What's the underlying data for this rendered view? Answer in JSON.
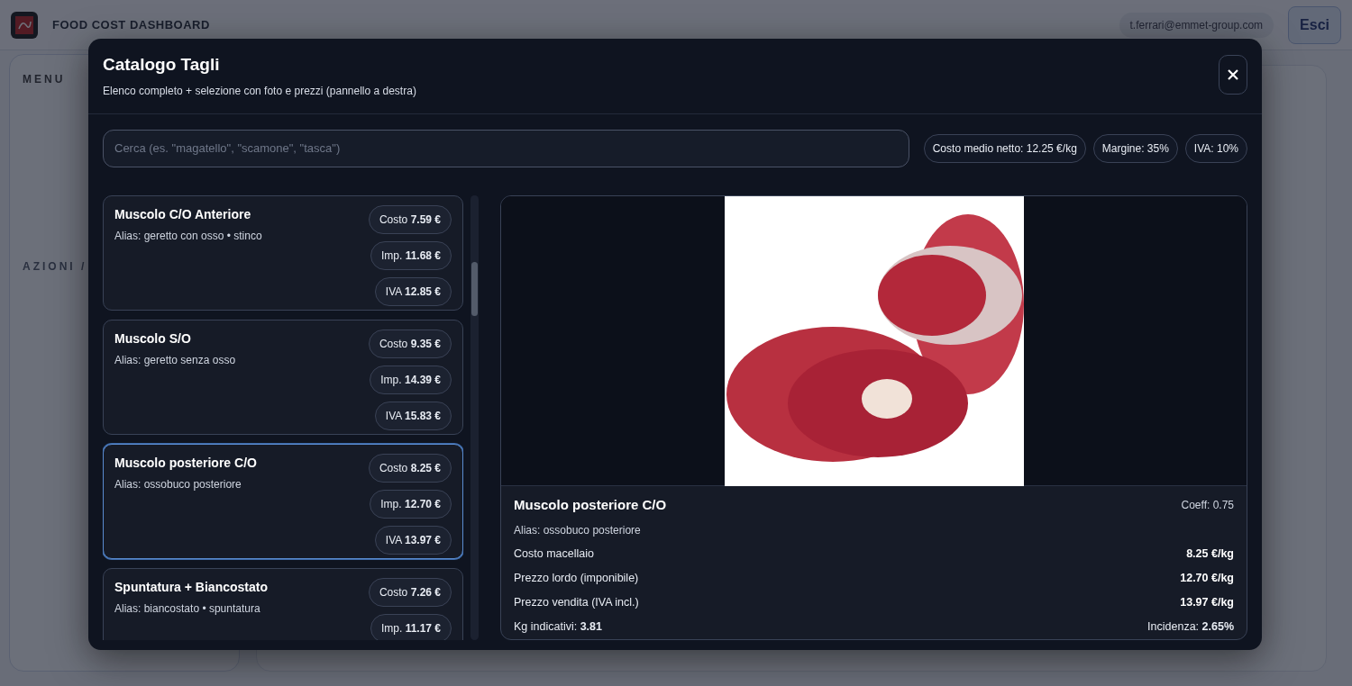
{
  "header": {
    "title": "FOOD COST DASHBOARD",
    "user_email": "t.ferrari@emmet-group.com",
    "logout": "Esci"
  },
  "sidebar": {
    "menu_label": "MENU",
    "section_label": "AZIONI /"
  },
  "modal": {
    "title": "Catalogo Tagli",
    "subtitle": "Elenco completo + selezione con foto e prezzi (pannello a destra)",
    "search": {
      "placeholder": "Cerca (es. \"magatello\", \"scamone\", \"tasca\")"
    },
    "stats": [
      "Costo medio netto: 12.25 €/kg",
      "Margine: 35%",
      "IVA: 10%"
    ],
    "cuts": [
      {
        "name": "Muscolo C/O Anteriore",
        "alias": "Alias: geretto con osso • stinco",
        "selected": false,
        "prices": [
          "Costo **7.59 €**",
          "Imp. **11.68 €**",
          "IVA **12.85 €**"
        ]
      },
      {
        "name": "Muscolo S/O",
        "alias": "Alias: geretto senza osso",
        "selected": false,
        "prices": [
          "Costo **9.35 €**",
          "Imp. **14.39 €**",
          "IVA **15.83 €**"
        ]
      },
      {
        "name": "Muscolo posteriore C/O",
        "alias": "Alias: ossobuco posteriore",
        "selected": true,
        "prices": [
          "Costo **8.25 €**",
          "Imp. **12.70 €**",
          "IVA **13.97 €**"
        ]
      },
      {
        "name": "Spuntatura + Biancostato",
        "alias": "Alias: biancostato • spuntatura",
        "selected": false,
        "prices": [
          "Costo **7.26 €**",
          "Imp. **11.17 €**"
        ]
      }
    ],
    "detail": {
      "name": "Muscolo posteriore C/O",
      "coeff": "Coeff: 0.75",
      "alias": "Alias: ossobuco posteriore",
      "rows": [
        {
          "label": "Costo macellaio",
          "value": "8.25 €/kg"
        },
        {
          "label": "Prezzo lordo (imponibile)",
          "value": "12.70 €/kg"
        },
        {
          "label": "Prezzo vendita (IVA incl.)",
          "value": "13.97 €/kg"
        }
      ],
      "kg": "Kg indicativi: **3.81**",
      "incidence": "Incidenza: **2.65%**"
    }
  }
}
